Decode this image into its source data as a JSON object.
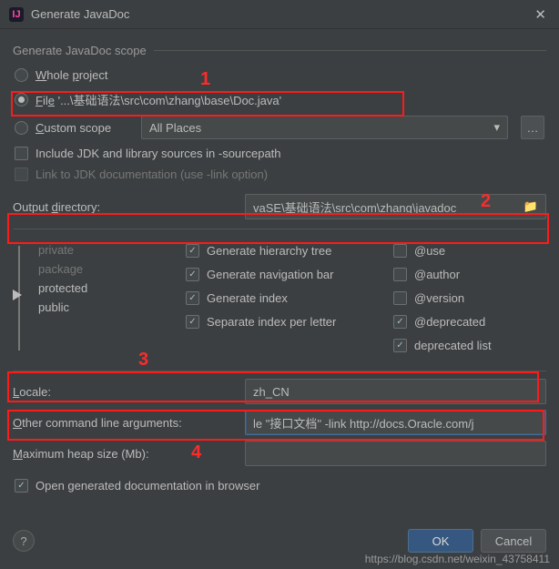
{
  "title": "Generate JavaDoc",
  "scope": {
    "group_label": "Generate JavaDoc scope",
    "whole_project": "Whole project",
    "file_option_prefix": "File '...\\基础语法\\src\\com\\zhang\\base\\Doc.java'",
    "custom_scope": "Custom scope",
    "custom_value": "All Places",
    "include_jdk": "Include JDK and library sources in -sourcepath",
    "link_jdk": "Link to JDK documentation (use -link option)"
  },
  "output": {
    "label": "Output directory:",
    "value": "vaSE\\基础语法\\src\\com\\zhang\\javadoc"
  },
  "visibility": {
    "items": [
      "private",
      "package",
      "protected",
      "public"
    ]
  },
  "gen_opts": {
    "hierarchy": "Generate hierarchy tree",
    "navbar": "Generate navigation bar",
    "index": "Generate index",
    "separate": "Separate index per letter"
  },
  "tag_opts": {
    "use": "@use",
    "author": "@author",
    "version": "@version",
    "deprecated": "@deprecated",
    "deprecated_list": "deprecated list"
  },
  "locale": {
    "label": "Locale:",
    "value": "zh_CN"
  },
  "other_args": {
    "label": "Other command line arguments:",
    "value": "le \"接口文档\" -link http://docs.Oracle.com/j"
  },
  "heap": {
    "label": "Maximum heap size (Mb):",
    "value": ""
  },
  "open_browser": "Open generated documentation in browser",
  "buttons": {
    "ok": "OK",
    "cancel": "Cancel"
  },
  "annotations": {
    "n1": "1",
    "n2": "2",
    "n3": "3",
    "n4": "4"
  },
  "watermark": "https://blog.csdn.net/weixin_43758411"
}
